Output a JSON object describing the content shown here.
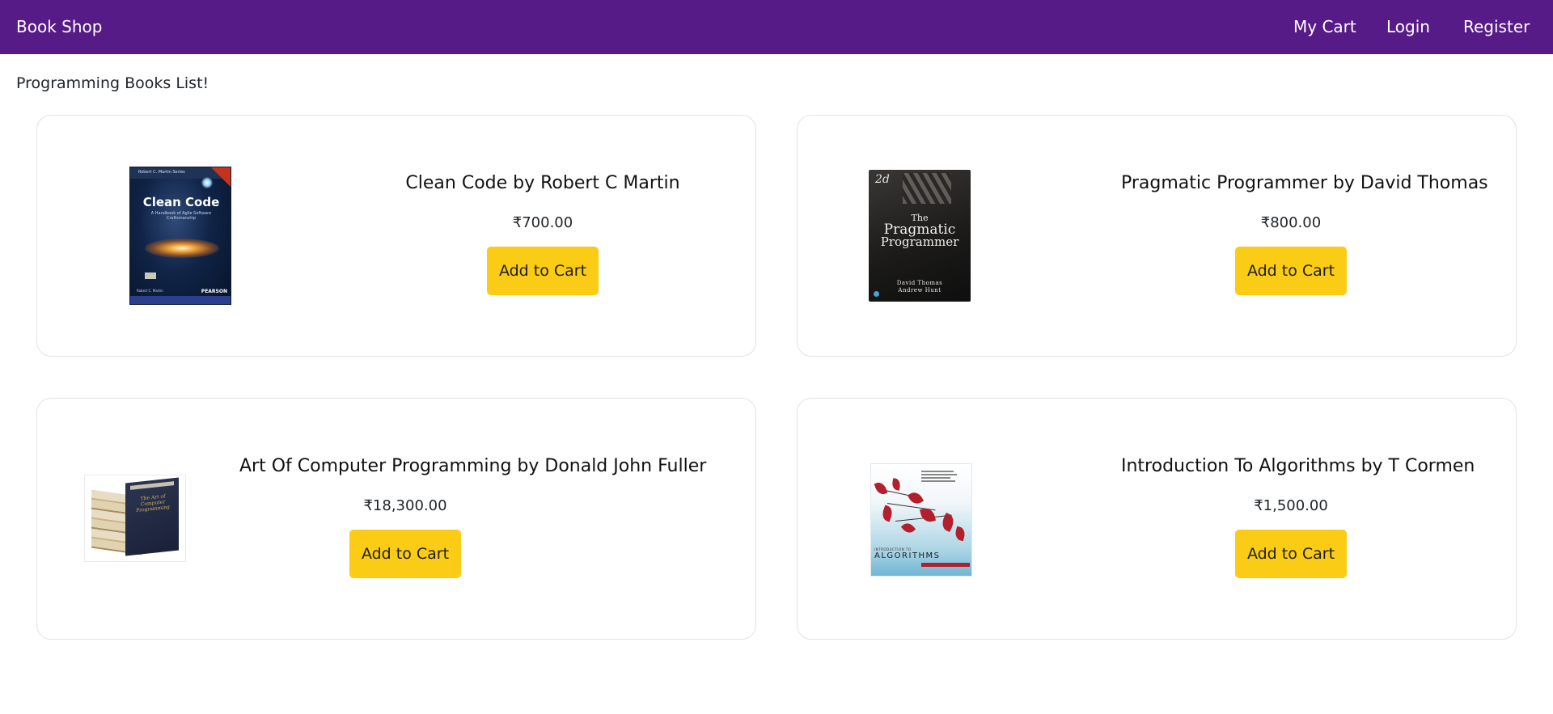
{
  "nav": {
    "brand": "Book Shop",
    "links": [
      {
        "label": "My Cart"
      },
      {
        "label": "Login"
      },
      {
        "label": "Register"
      }
    ]
  },
  "page": {
    "heading": "Programming Books List!"
  },
  "books": [
    {
      "title": "Clean Code by Robert C Martin",
      "price": "₹700.00",
      "button": "Add to Cart",
      "cover": {
        "series": "Robert C. Martin Series",
        "title": "Clean Code",
        "subtitle": "A Handbook of Agile Software Craftsmanship",
        "author": "Robert C. Martin",
        "publisher": "PEARSON"
      }
    },
    {
      "title": "Pragmatic Programmer by David Thomas",
      "price": "₹800.00",
      "button": "Add to Cart",
      "cover": {
        "edition": "2d",
        "the": "The",
        "word1": "Pragmatic",
        "word2": "Programmer",
        "author1": "David Thomas",
        "author2": "Andrew Hunt"
      }
    },
    {
      "title": "Art Of Computer Programming by Donald John Fuller",
      "price": "₹18,300.00",
      "button": "Add to Cart",
      "cover": {
        "box_title": "The Art of Computer Programming"
      }
    },
    {
      "title": "Introduction To Algorithms by T Cormen",
      "price": "₹1,500.00",
      "button": "Add to Cart",
      "cover": {
        "top": "INTRODUCTION TO",
        "title": "ALGORITHMS"
      }
    }
  ],
  "colors": {
    "navbar": "#571b87",
    "button": "#facc15",
    "card_border": "#e1e3e6"
  }
}
